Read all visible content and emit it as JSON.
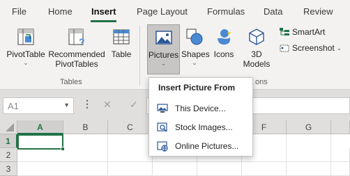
{
  "tabs": [
    {
      "label": "File"
    },
    {
      "label": "Home"
    },
    {
      "label": "Insert"
    },
    {
      "label": "Page Layout"
    },
    {
      "label": "Formulas"
    },
    {
      "label": "Data"
    },
    {
      "label": "Review"
    }
  ],
  "ribbon": {
    "pivot_table": "PivotTable",
    "recommended_line1": "Recommended",
    "recommended_line2": "PivotTables",
    "table": "Table",
    "tables_group": "Tables",
    "pictures": "Pictures",
    "shapes": "Shapes",
    "icons": "Icons",
    "models_line1": "3D",
    "models_line2": "Models",
    "smartart": "SmartArt",
    "screenshot": "Screenshot",
    "illustrations_group_partial": "ons"
  },
  "formula_bar": {
    "name_box": "A1",
    "separator": "⋮",
    "cancel": "✕",
    "enter": "✓"
  },
  "grid": {
    "columns": [
      "A",
      "B",
      "C",
      "D",
      "E",
      "F",
      "G"
    ],
    "rows": [
      "1",
      "2",
      "3"
    ],
    "selected_cell": "A1"
  },
  "dropdown": {
    "title": "Insert Picture From",
    "items": [
      {
        "label": "This Device...",
        "icon": "this-device-icon"
      },
      {
        "label": "Stock Images...",
        "icon": "stock-images-icon"
      },
      {
        "label": "Online Pictures...",
        "icon": "online-pictures-icon"
      }
    ]
  },
  "colors": {
    "accent": "#217346",
    "pressed": "#c8c6c4"
  }
}
